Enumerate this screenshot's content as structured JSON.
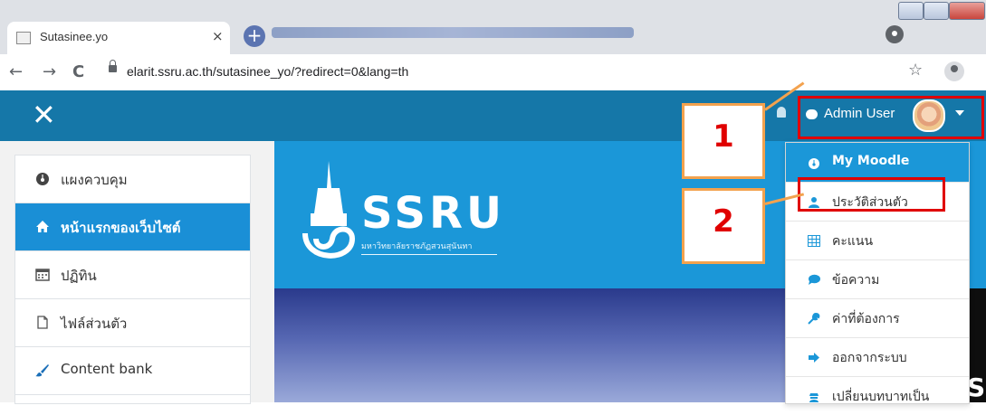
{
  "browser": {
    "tab_title": "Sutasinee.yo",
    "tab_close": "×",
    "new_tab": "+",
    "url": "elarit.ssru.ac.th/sutasinee_yo/?redirect=0&lang=th",
    "back": "←",
    "forward": "→",
    "reload": "C",
    "bookmark": "☆"
  },
  "navbar": {
    "close": "✕",
    "user_name": "Admin User"
  },
  "drawer": {
    "items": [
      {
        "label": "แผงควบคุม",
        "icon": "dashboard-icon"
      },
      {
        "label": "หน้าแรกของเว็บไซต์",
        "icon": "home-icon",
        "active": true
      },
      {
        "label": "ปฏิทิน",
        "icon": "calendar-icon"
      },
      {
        "label": "ไฟล์ส่วนตัว",
        "icon": "file-icon"
      },
      {
        "label": "Content bank",
        "icon": "paint-brush-icon"
      }
    ]
  },
  "banner": {
    "logo_text": "SSRU",
    "logo_subtitle": "มหาวิทยาลัยราชภัฏสวนสุนันทา",
    "hero_glyph": "S"
  },
  "user_dropdown": {
    "items": [
      {
        "label": "My Moodle",
        "icon": "tachometer-icon"
      },
      {
        "label": "ประวัติส่วนตัว",
        "icon": "user-icon"
      },
      {
        "label": "คะแนน",
        "icon": "grid-icon"
      },
      {
        "label": "ข้อความ",
        "icon": "comment-icon"
      },
      {
        "label": "ค่าที่ต้องการ",
        "icon": "wrench-icon"
      },
      {
        "label": "ออกจากระบบ",
        "icon": "sign-out-icon"
      },
      {
        "label": "เปลี่ยนบทบาทเป็น",
        "icon": "user-secret-icon"
      }
    ]
  },
  "annotations": {
    "step1": "1",
    "step2": "2"
  },
  "colors": {
    "navbar": "#1577a8",
    "accent": "#1b97d8",
    "highlight": "#e00000",
    "callout": "#f3a24e"
  }
}
